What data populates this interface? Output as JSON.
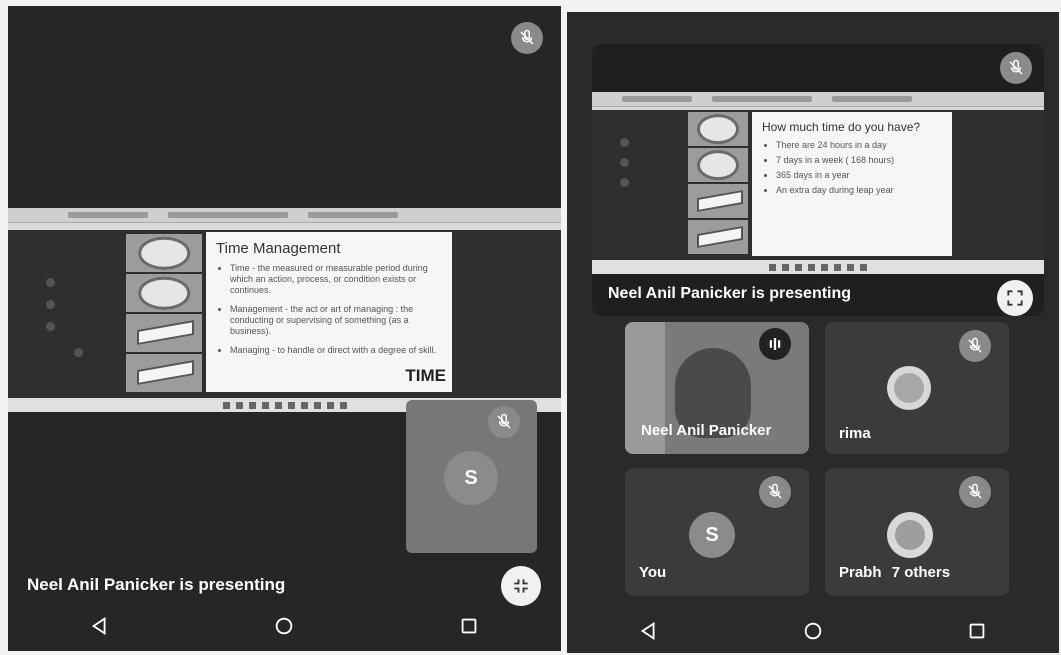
{
  "left": {
    "slide": {
      "title": "Time Management",
      "bullets": [
        "Time - the measured or measurable period during which an action, process, or condition exists or continues.",
        "Management - the act or art of managing : the conducting or supervising of something (as a business).",
        "Managing - to handle or direct with a degree of skill."
      ],
      "logo": "TIME"
    },
    "self_avatar_letter": "S",
    "presenting_text": "Neel Anil Panicker is presenting"
  },
  "right": {
    "slide": {
      "title": "How much time do you have?",
      "lines": [
        "There are 24 hours in a day",
        "7 days in a week ( 168 hours)",
        "365 days in a year",
        "An extra day during leap year"
      ]
    },
    "presenting_text": "Neel Anil Panicker is presenting",
    "tiles": {
      "presenter_name": "Neel Anil Panicker",
      "rima_name": "rima",
      "you_name": "You",
      "you_letter": "S",
      "others_prefix": "Prabh",
      "others_label": "7 others"
    }
  },
  "icons": {
    "mic_off": "mic-off-icon",
    "fullscreen": "fullscreen-icon",
    "exit_fullscreen": "exit-fullscreen-icon",
    "speaking": "speaking-indicator-icon",
    "nav_back": "nav-back-icon",
    "nav_home": "nav-home-icon",
    "nav_recent": "nav-recent-apps-icon"
  }
}
